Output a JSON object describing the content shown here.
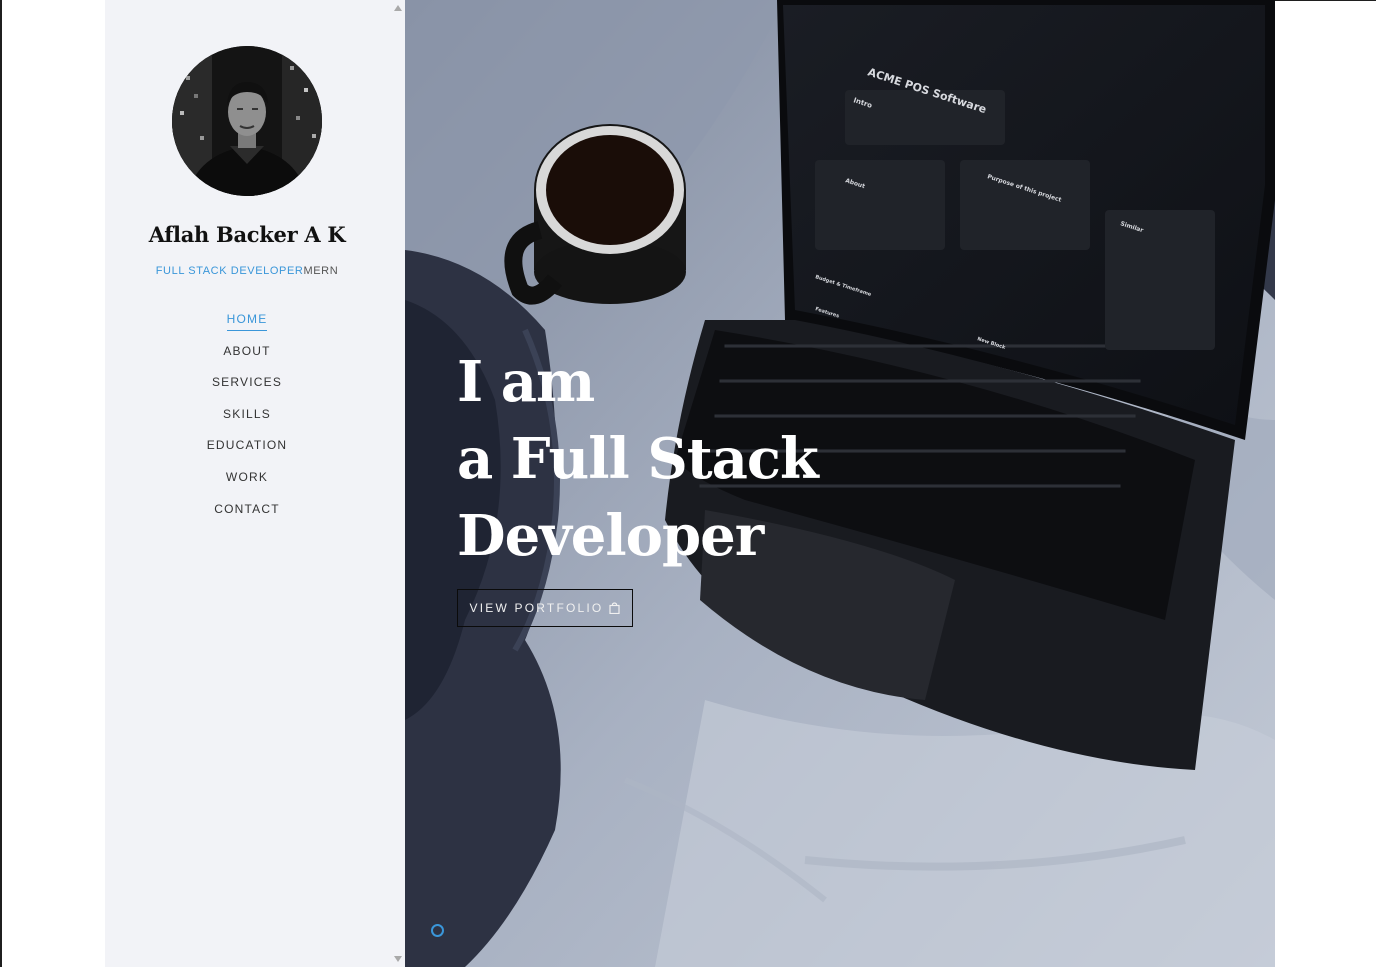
{
  "profile": {
    "name": "Aflah Backer A K",
    "role_main": "FULL STACK DEVELOPER",
    "role_tag": "MERN"
  },
  "nav": {
    "items": [
      {
        "label": "HOME",
        "active": true
      },
      {
        "label": "ABOUT",
        "active": false
      },
      {
        "label": "SERVICES",
        "active": false
      },
      {
        "label": "SKILLS",
        "active": false
      },
      {
        "label": "EDUCATION",
        "active": false
      },
      {
        "label": "WORK",
        "active": false
      },
      {
        "label": "CONTACT",
        "active": false
      }
    ]
  },
  "hero": {
    "line1": "I am",
    "line2": "a Full Stack",
    "line3": "Developer",
    "button_label": "VIEW PORTFOLIO",
    "button_icon": "shopping-bag-icon",
    "laptop_screen": {
      "title": "ACME POS Software",
      "section_intro": "Intro",
      "card_about": "About",
      "card_purpose": "Purpose of this project",
      "card_similar": "Similar",
      "section_budget": "Budget & Timeframe",
      "section_features": "Features",
      "new_block": "New Block"
    }
  },
  "colors": {
    "accent": "#3a96d9",
    "sidebar_bg": "#f2f3f7",
    "text_dark": "#111111"
  }
}
